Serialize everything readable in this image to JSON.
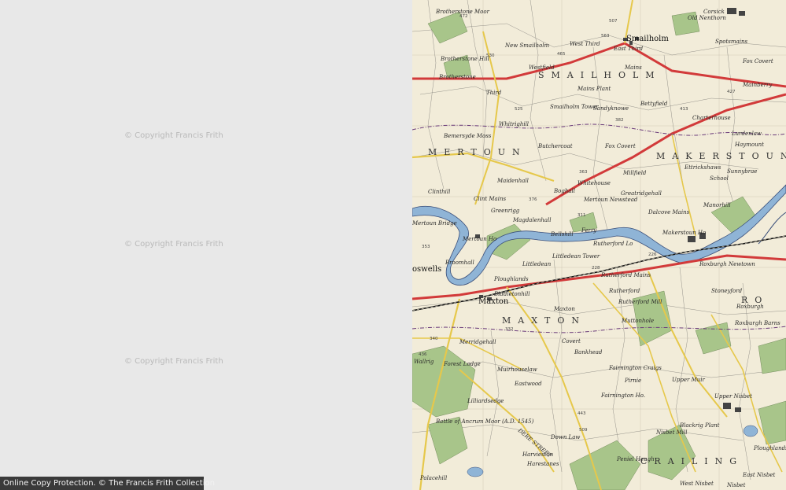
{
  "watermark": {
    "text": "© Copyright Francis Frith"
  },
  "protection_notice": "Online Copy Protection. © The Francis Frith Collection",
  "map": {
    "towns": {
      "smailholm": "Smailholm",
      "maxton": "Maxton",
      "boswells": "oswells"
    },
    "parishes": {
      "smailholm": "SMAILHOLM",
      "mertoun": "MERTOUN",
      "makerstoun": "MAKERSTOUN",
      "maxton": "MAXTON",
      "roxburgh": "RO",
      "crailing": "CRAILING"
    },
    "places": {
      "brotherstone_moor": "Brotherstone Moor",
      "brotherstone_hill": "Brotherstone Hill",
      "brotherstone": "Brotherstone",
      "new_smailholm": "New Smailholm",
      "west_third": "West Third",
      "westfield": "Westfield",
      "east_third": "East Third",
      "mains": "Mains",
      "mains_plant": "Mains Plant",
      "third": "Third",
      "whitrighill": "Whitrighill",
      "bemersyde_moss": "Bemersyde Moss",
      "smailholm_tower": "Smailholm Tower",
      "sandyknowe": "Sandyknowe",
      "bettyfield": "Bettyfield",
      "charterhouse": "Charterhouse",
      "lurdenlaw": "Lurdenlaw",
      "haymount": "Haymount",
      "sunnyside": "Sunnybrae",
      "makerstoun_mains": "Mainberry",
      "old_nenthorn": "Old Nenthorn",
      "corsick": "Corsick",
      "spotsmains": "Spotsmains",
      "fox_covert": "Fox Covert",
      "butchercoat": "Butchercoat",
      "maidenhall": "Maidenhall",
      "clintmains": "Clint Mains",
      "clinthill": "Clinthill",
      "greenrigg": "Greenrigg",
      "boghall": "Boghall",
      "whitehouse": "Whitehouse",
      "mertoun_newstead": "Mertoun Newstead",
      "greatridgehall": "Greatridgehall",
      "millfield": "Millfield",
      "ettrickhaugh": "Ettrickshaws",
      "school": "School",
      "manorhill": "Manorhill",
      "dalcove_mains": "Dalcove Mains",
      "makerstoun_ho": "Makerstoun Ho",
      "magdalenhall": "Magdalenhall",
      "bellshill": "Bellshill",
      "ferry": "Ferry",
      "rutherford_lodge": "Rutherford Lo",
      "littledean_tower": "Littledean Tower",
      "littledean": "Littledean",
      "ploughlands": "Ploughlands",
      "mertoun_bridge": "Mertoun Bridge",
      "mertoun_ho": "Mertoun Ho",
      "broomhall": "Broomhall",
      "biddletonhill": "Biddletonhill",
      "rutherford": "Rutherford",
      "rutherford_mains": "Rutherford Mains",
      "rutherford_mill": "Rutherford Mill",
      "stoneyford": "Stoneyford",
      "roxburgh_newtown": "Roxburgh Newtown",
      "muttonhole": "Muttonhole",
      "roxburgh_barns": "Roxburgh Barns",
      "merridgehall": "Merridgehall",
      "covert": "Covert",
      "bankhead": "Bankhead",
      "fairnington_craigs": "Fairnington Craigs",
      "pirnie": "Pirnie",
      "fairnington_ho": "Fairnington Ho.",
      "forest_lodge": "Forest Lodge",
      "muirhouselaw": "Muirhouselaw",
      "eastwood": "Eastwood",
      "lilliardsedge": "Lilliardsedge",
      "battle_of_ancrum": "Battle of Ancrum Moor (A.D. 1545)",
      "dere_street": "DERE STREET",
      "down_law": "Down Law",
      "harestanes": "Harestanes",
      "nisbet_mill": "Nisbet Mill",
      "blackrig": "Blackrig Plant",
      "upper_nisbet": "Upper Nisbet",
      "ploughlands_se": "Ploughlands",
      "east_nisbet": "East Nisbet",
      "west_nisbet": "West Nisbet",
      "nisbet": "Nisbet",
      "peniel_heugh": "Peniel Heugh",
      "palacehill": "Palacehill",
      "wallrig": "Wallrig",
      "rowleyhall": "Harvieston",
      "cleared_mill": "Maxton",
      "temple_moor": "Upper Muir",
      "fox_covert_ne": "Fox Covert",
      "roxburgh_mill": "Roxburgh"
    },
    "spot_heights": [
      "563",
      "530",
      "413",
      "465",
      "507",
      "382",
      "363",
      "311",
      "228",
      "443",
      "509",
      "427",
      "525",
      "472",
      "376",
      "332",
      "353",
      "340",
      "436",
      "226"
    ],
    "colors": {
      "paper": "#f2ecd9",
      "river": "#8fb4d6",
      "river_edge": "#3a4f7a",
      "road_red": "#d23a3a",
      "road_yellow": "#e6c84b",
      "woodland": "#a8c58a",
      "railway": "#111111",
      "boundary": "#6a3b7a"
    }
  }
}
